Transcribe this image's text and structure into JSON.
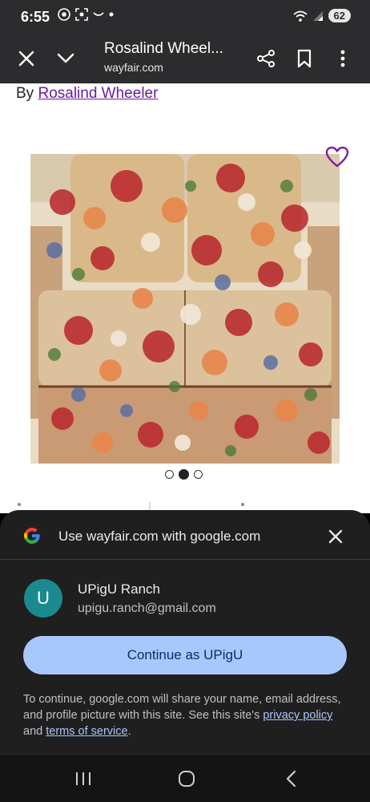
{
  "status_bar": {
    "time": "6:55",
    "battery": "62"
  },
  "toolbar": {
    "title": "Rosalind Wheel...",
    "url": "wayfair.com"
  },
  "page": {
    "byline_prefix": "By",
    "brand": "Rosalind Wheeler",
    "carousel_dots": 3,
    "carousel_active_index": 1
  },
  "sheet": {
    "title": "Use wayfair.com with google.com",
    "account": {
      "initial": "U",
      "name": "UPigU Ranch",
      "email": "upigu.ranch@gmail.com"
    },
    "continue_label": "Continue as UPigU",
    "disclaimer_text": "To continue, google.com will share your name, email address, and profile picture with this site. See this site's",
    "privacy_link": "privacy policy",
    "and_text": "and",
    "terms_link": "terms of service",
    "period": "."
  },
  "colors": {
    "accent": "#a8c7fa",
    "brand_link": "#6a1b9a",
    "avatar": "#1a8a8f"
  }
}
